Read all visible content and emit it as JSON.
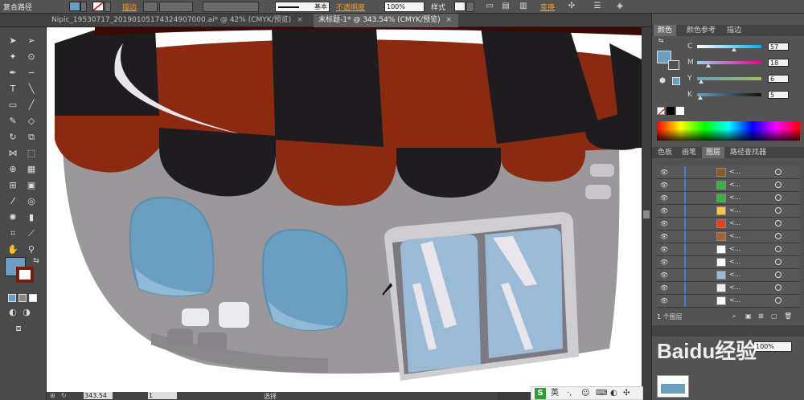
{
  "control_bar": {
    "object_type": "复合路径",
    "stroke_label": "描边",
    "stroke_style": "基本",
    "opacity_label": "不透明度",
    "opacity_value": "100%",
    "style_label": "样式",
    "transform_label": "变换"
  },
  "tabs": [
    {
      "label": "Nipic_19530717_20190105174324907000.ai* @ 42% (CMYK/预览)",
      "active": false
    },
    {
      "label": "未标题-1* @ 343.54% (CMYK/预览)",
      "active": true
    }
  ],
  "color_panel": {
    "tabs": [
      "颜色",
      "颜色参考",
      "描边"
    ],
    "channels": [
      {
        "name": "C",
        "value": "57",
        "level": 0.57,
        "color": "#00aeef"
      },
      {
        "name": "M",
        "value": "18",
        "level": 0.18,
        "color": "#ec008c"
      },
      {
        "name": "Y",
        "value": "6",
        "level": 0.06,
        "color": "#fff200"
      },
      {
        "name": "K",
        "value": "5",
        "level": 0.05,
        "color": "#231f20"
      }
    ],
    "fill_color": "#6a9fc2"
  },
  "layers_panel": {
    "tabs": [
      "色板",
      "画笔",
      "图层",
      "路径查找器"
    ],
    "rows": [
      {
        "thumb": "#8b5a2b"
      },
      {
        "thumb": "#3cb043"
      },
      {
        "thumb": "#3cb043"
      },
      {
        "thumb": "#f2c94c"
      },
      {
        "thumb": "#e8401c"
      },
      {
        "thumb": "#a0643c"
      },
      {
        "thumb": "#ffffff"
      },
      {
        "thumb": "#ffffff"
      },
      {
        "thumb": "#9bbad6"
      },
      {
        "thumb": "#eeeeee"
      },
      {
        "thumb": "#ffffff"
      }
    ],
    "row_label": "<...",
    "footer": "1 个图层",
    "secondary_opacity": "100%"
  },
  "status_bar": {
    "zoom": "343.54",
    "page": "1",
    "mode": "选择"
  },
  "taskbar": {
    "ime": "英"
  },
  "watermark": "Baidu经验",
  "colors": {
    "fill": "#6a9fc2",
    "roof_brown": "#8b2a10",
    "roof_black": "#1e1c1f",
    "wall": "#9a989b",
    "window_blue": "#6a9fc2"
  }
}
